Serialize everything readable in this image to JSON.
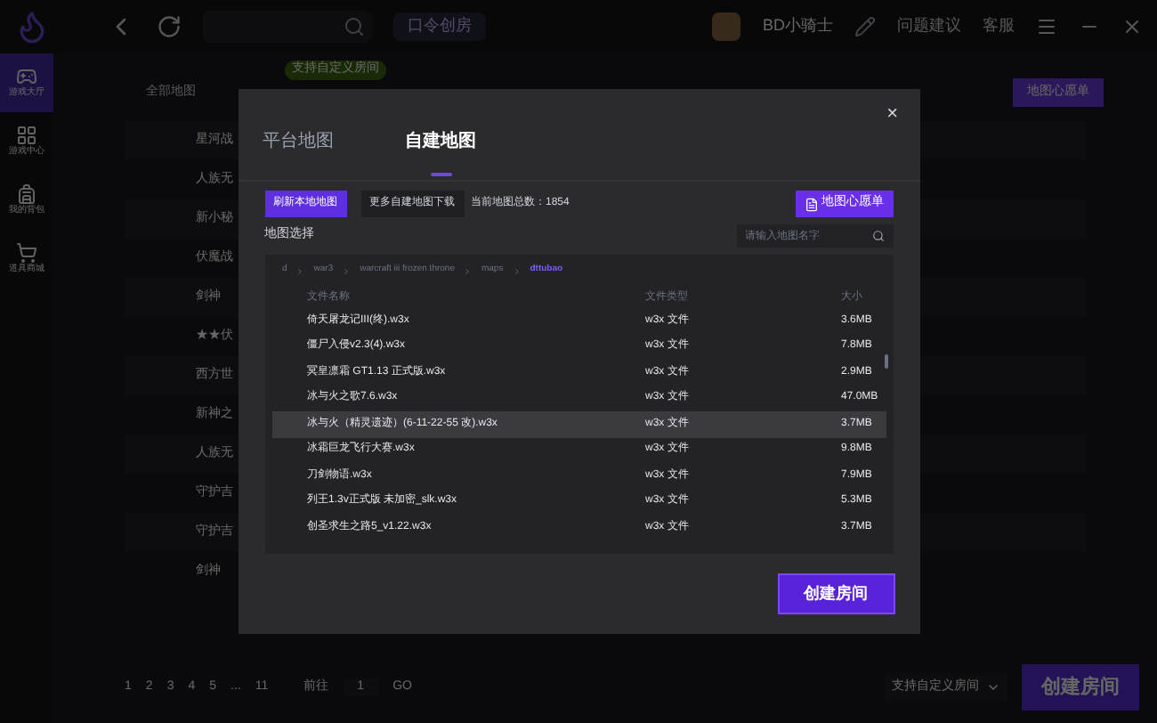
{
  "topbar": {
    "room_code_button": "口令创房",
    "username": "BD小骑士",
    "links": [
      "问题建议",
      "客服"
    ]
  },
  "sidebar": {
    "items": [
      {
        "label": "游戏大厅",
        "selected": true
      },
      {
        "label": "游戏中心",
        "selected": false
      },
      {
        "label": "我的背包",
        "selected": false
      },
      {
        "label": "道具商城",
        "selected": false
      }
    ]
  },
  "main": {
    "tab": "全部地图",
    "badge": "支持自定义房间",
    "wishlist_button": "地图心愿单",
    "rows": [
      "星河战",
      "人族无",
      "新小秘",
      "伏魔战",
      "剑神",
      "★★伏",
      "西方世",
      "新神之",
      "人族无",
      "守护吉",
      "守护吉",
      "剑神"
    ],
    "pagination": {
      "pages": [
        "1",
        "2",
        "3",
        "4",
        "5",
        "...",
        "11"
      ],
      "goto_label": "前往",
      "goto_value": "1",
      "go": "GO"
    },
    "room_type_select": "支持自定义房间",
    "create_button": "创建房间"
  },
  "dialog": {
    "tabs": [
      {
        "label": "平台地图",
        "selected": false
      },
      {
        "label": "自建地图",
        "selected": true
      }
    ],
    "close": "×",
    "refresh_button": "刷新本地地图",
    "download_button": "更多自建地图下载",
    "count_label": "当前地图总数：1854",
    "wishlist_button": "地图心愿单",
    "section_title": "地图选择",
    "search": {
      "placeholder": "请输入地图名字"
    },
    "breadcrumb": [
      {
        "label": "d",
        "selected": false
      },
      {
        "label": "war3",
        "selected": false
      },
      {
        "label": "warcraft iii frozen throne",
        "selected": false
      },
      {
        "label": "maps",
        "selected": false
      },
      {
        "label": "dttubao",
        "selected": true
      }
    ],
    "table": {
      "columns": [
        "文件名称",
        "文件类型",
        "大小"
      ],
      "rows": [
        {
          "name": "倚天屠龙记III(终).w3x",
          "type": "w3x 文件",
          "size": "3.6MB",
          "selected": false
        },
        {
          "name": "僵尸入侵v2.3(4).w3x",
          "type": "w3x 文件",
          "size": "7.8MB",
          "selected": false
        },
        {
          "name": "冥皇凛霜 GT1.13 正式版.w3x",
          "type": "w3x 文件",
          "size": "2.9MB",
          "selected": false
        },
        {
          "name": "冰与火之歌7.6.w3x",
          "type": "w3x 文件",
          "size": "47.0MB",
          "selected": false
        },
        {
          "name": "冰与火（精灵遗迹）(6-11-22-55 改).w3x",
          "type": "w3x 文件",
          "size": "3.7MB",
          "selected": true
        },
        {
          "name": "冰霜巨龙飞行大赛.w3x",
          "type": "w3x 文件",
          "size": "9.8MB",
          "selected": false
        },
        {
          "name": "刀剑物语.w3x",
          "type": "w3x 文件",
          "size": "7.9MB",
          "selected": false
        },
        {
          "name": "列王1.3v正式版 未加密_slk.w3x",
          "type": "w3x 文件",
          "size": "5.3MB",
          "selected": false
        },
        {
          "name": "创圣求生之路5_v1.22.w3x",
          "type": "w3x 文件",
          "size": "3.7MB",
          "selected": false
        }
      ]
    },
    "create_button": "创建房间"
  }
}
